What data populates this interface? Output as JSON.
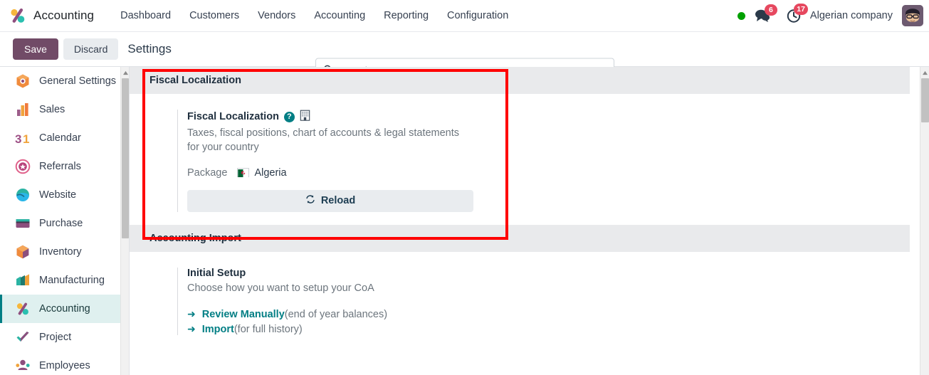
{
  "navbar": {
    "brand": "Accounting",
    "brand_logo_icon": "odoo-accounting-logo-icon",
    "menu": [
      {
        "label": "Dashboard"
      },
      {
        "label": "Customers"
      },
      {
        "label": "Vendors"
      },
      {
        "label": "Accounting"
      },
      {
        "label": "Reporting"
      },
      {
        "label": "Configuration"
      }
    ],
    "status_indicator_color": "#00a000",
    "messages": {
      "icon": "chat-bubble-icon",
      "count": "6"
    },
    "activities": {
      "icon": "clock-icon",
      "count": "17"
    },
    "company": "Algerian company",
    "avatar_icon": "user-avatar"
  },
  "control_panel": {
    "save_label": "Save",
    "discard_label": "Discard",
    "title": "Settings",
    "save_color": "#714b67",
    "search": {
      "placeholder": "Search...",
      "value": "",
      "icon": "search-icon"
    }
  },
  "sidebar": {
    "items": [
      {
        "label": "General Settings",
        "icon": "settings-gear-app-icon",
        "active": false
      },
      {
        "label": "Sales",
        "icon": "sales-bars-icon",
        "active": false
      },
      {
        "label": "Calendar",
        "icon": "calendar-31-icon",
        "active": false
      },
      {
        "label": "Referrals",
        "icon": "referrals-shield-icon",
        "active": false
      },
      {
        "label": "Website",
        "icon": "website-globe-icon",
        "active": false
      },
      {
        "label": "Purchase",
        "icon": "purchase-card-icon",
        "active": false
      },
      {
        "label": "Inventory",
        "icon": "inventory-box-icon",
        "active": false
      },
      {
        "label": "Manufacturing",
        "icon": "manufacturing-factory-icon",
        "active": false
      },
      {
        "label": "Accounting",
        "icon": "accounting-percent-icon",
        "active": true
      },
      {
        "label": "Project",
        "icon": "project-check-icon",
        "active": false
      },
      {
        "label": "Employees",
        "icon": "employees-people-icon",
        "active": false
      }
    ],
    "active_color": "#017e84",
    "active_bg": "#dff0ef"
  },
  "main": {
    "fiscal_localization": {
      "block_header": "Fiscal Localization",
      "setting_title": "Fiscal Localization",
      "help_icon": "help-question-icon",
      "company_icon": "company-building-icon",
      "description": "Taxes, fiscal positions, chart of accounts & legal statements for your country",
      "package_label": "Package",
      "package_value": "Algeria",
      "package_flag_icon": "flag-algeria-icon",
      "reload_label": "Reload",
      "reload_icon": "refresh-icon"
    },
    "accounting_import": {
      "block_header": "Accounting Import",
      "setting_title": "Initial Setup",
      "description": "Choose how you want to setup your CoA",
      "links": [
        {
          "icon": "arrow-right-icon",
          "label": "Review Manually",
          "note": "(end of year balances)"
        },
        {
          "icon": "arrow-right-icon",
          "label": "Import",
          "note": "(for full history)"
        }
      ]
    }
  },
  "annotation": {
    "color": "#ff0000",
    "target": "fiscal-localization-panel"
  }
}
